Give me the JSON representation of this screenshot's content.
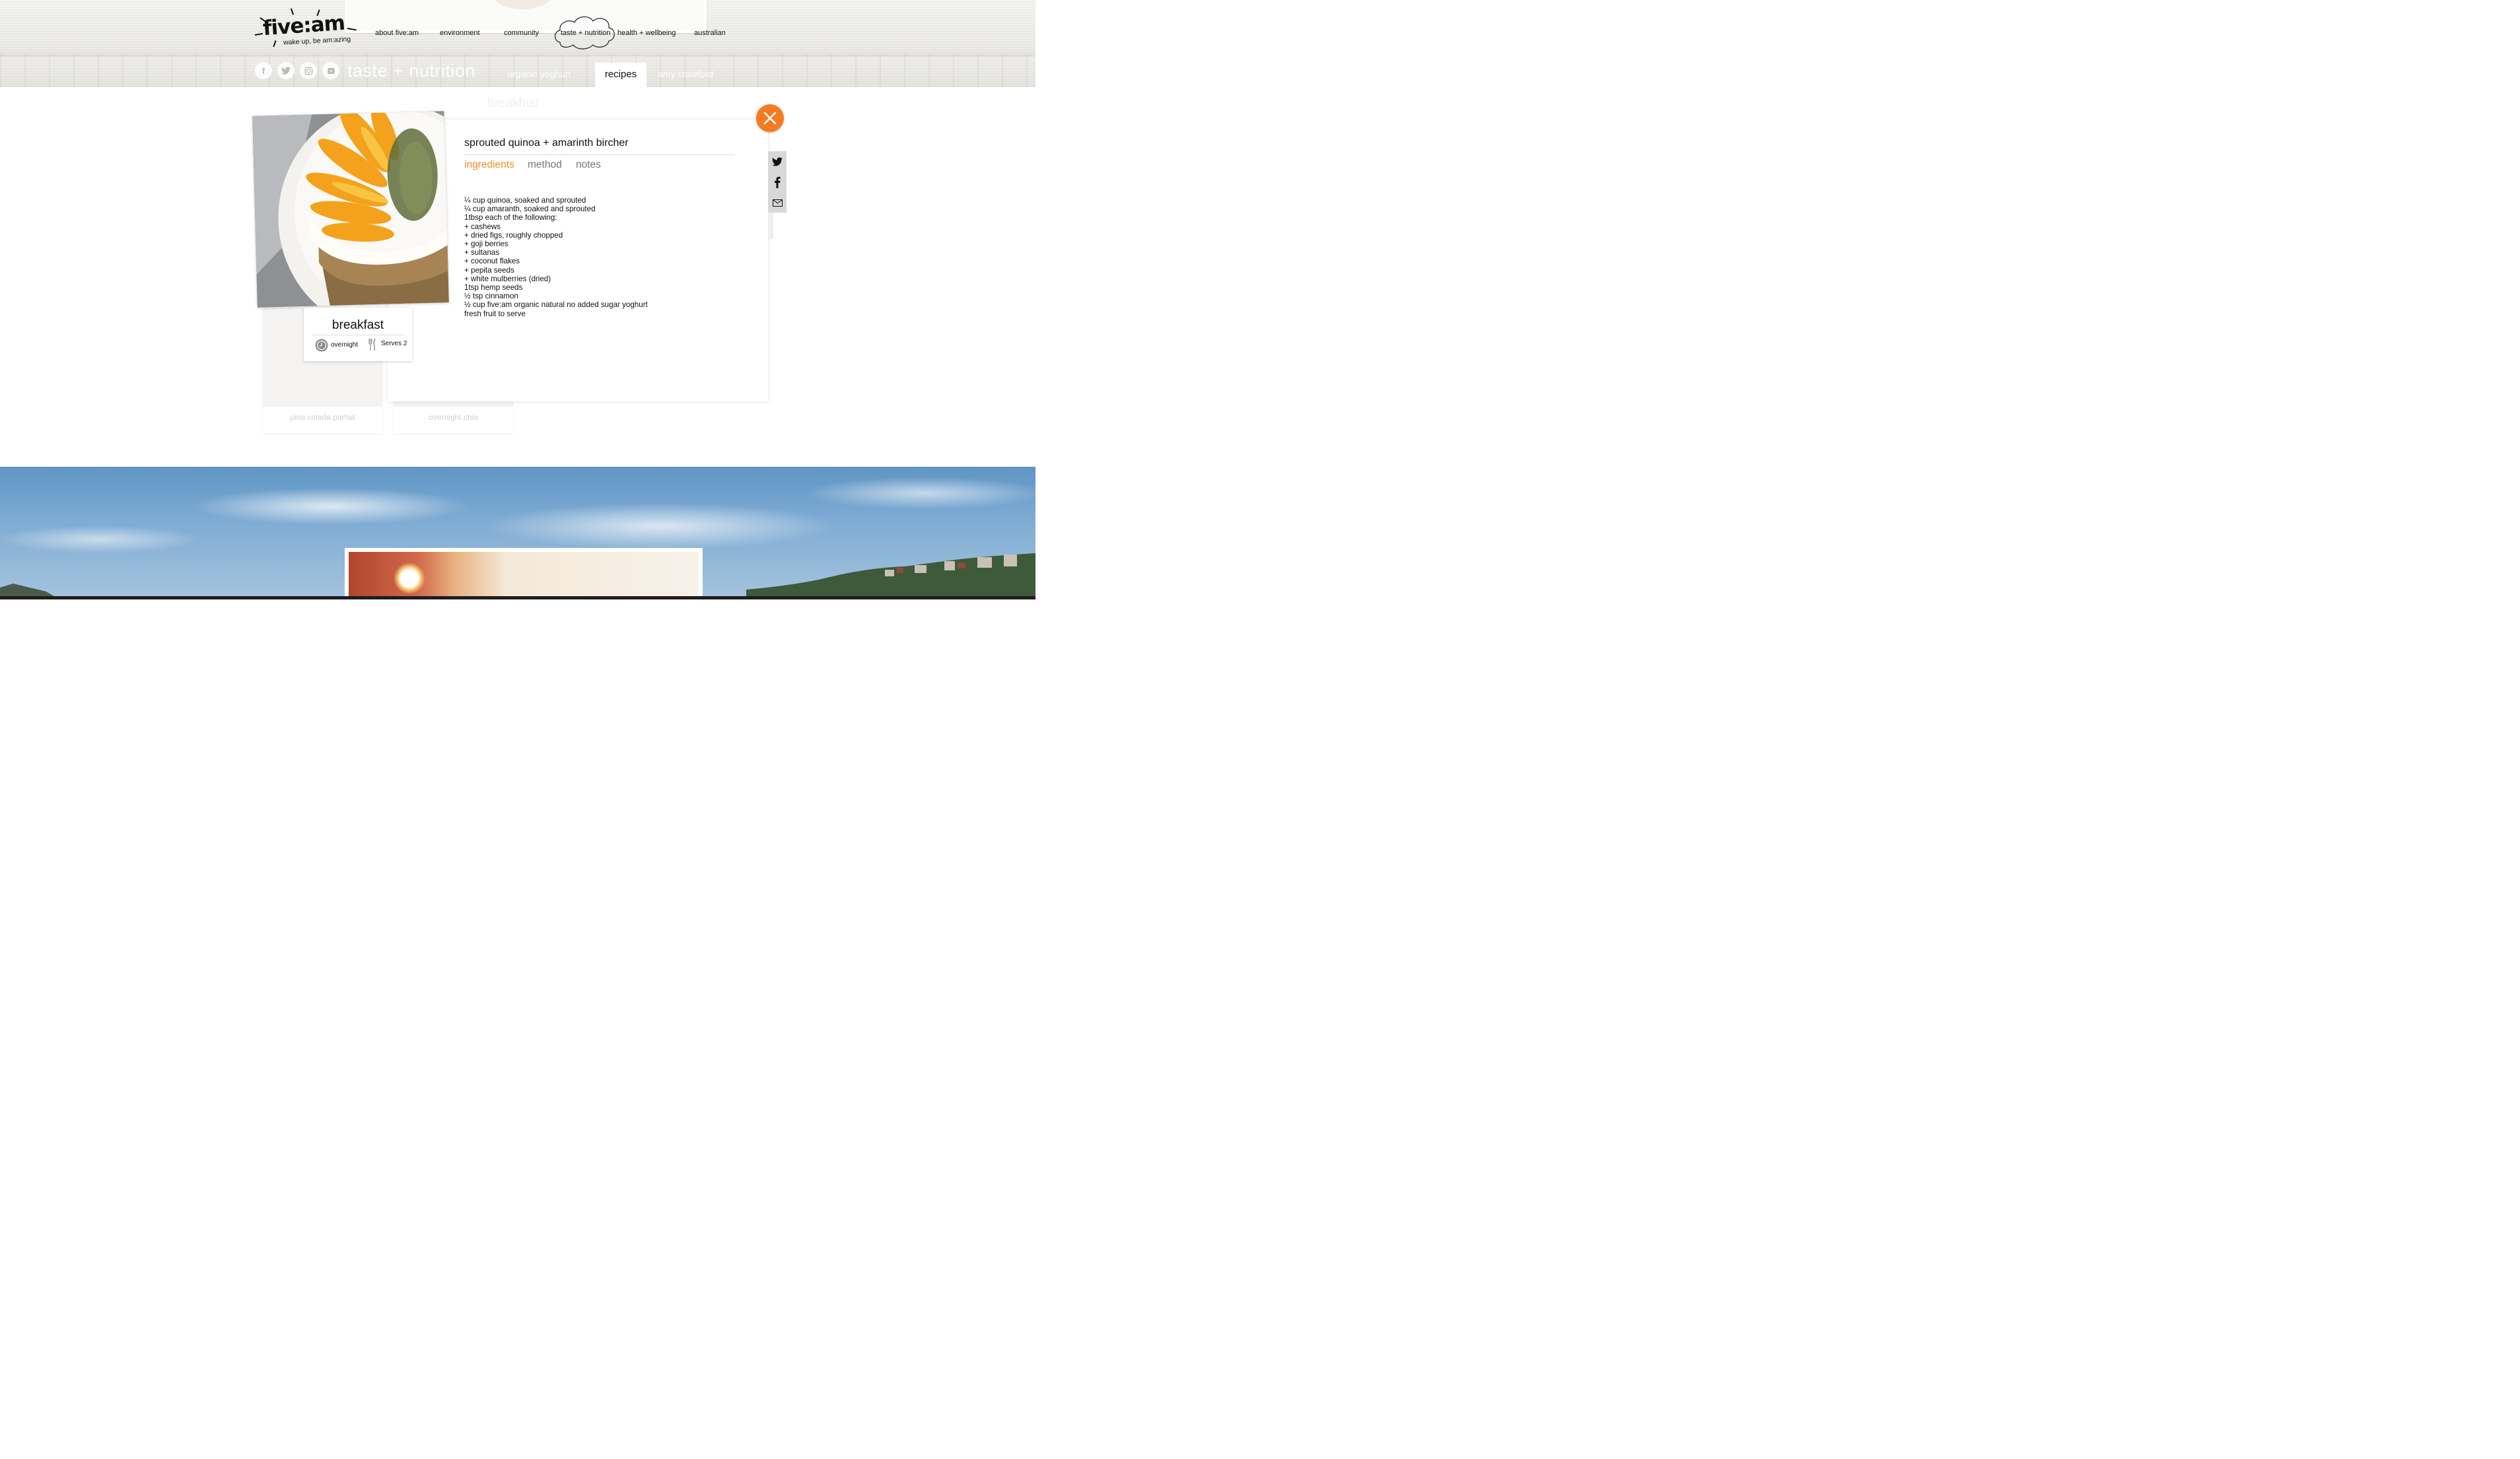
{
  "brand": {
    "name": "five:am",
    "tagline": "wake up, be am:azing"
  },
  "nav": {
    "items": [
      {
        "label": "about five:am"
      },
      {
        "label": "environment"
      },
      {
        "label": "community"
      },
      {
        "label": "taste + nutrition",
        "active": true
      },
      {
        "label": "health + wellbeing"
      },
      {
        "label": "australian"
      }
    ]
  },
  "social_icons": [
    "facebook-icon",
    "twitter-icon",
    "instagram-icon",
    "youtube-icon"
  ],
  "section": {
    "title": "taste + nutrition",
    "tabs": [
      {
        "label": "organic yoghurt"
      },
      {
        "label": "recipes",
        "active": true
      },
      {
        "label": "amy crawford"
      }
    ]
  },
  "background_grid": {
    "heading": "breakfast",
    "cards": [
      {
        "caption": "pina colada parfait"
      },
      {
        "caption": "overnight chia"
      }
    ]
  },
  "recipe": {
    "title": "sprouted quinoa + amarinth bircher",
    "tabs": [
      {
        "label": "ingredients",
        "active": true
      },
      {
        "label": "method"
      },
      {
        "label": "notes"
      }
    ],
    "ingredients": [
      "¼ cup quinoa, soaked and sprouted",
      "¼ cup amaranth, soaked and sprouted",
      "1tbsp each of the following:",
      "+ cashews",
      "+ dried figs, roughly chopped",
      "+ goji berries",
      "+ sultanas",
      "+ coconut flakes",
      "+ pepita seeds",
      "+ white mulberries (dried)",
      "1tsp hemp seeds",
      "½ tsp cinnamon",
      "½ cup five:am organic natural no added sugar yoghurt",
      "fresh fruit to serve"
    ],
    "category": "breakfast",
    "time": "overnight",
    "serves": "Serves 2"
  },
  "share": [
    "twitter-icon",
    "facebook-icon",
    "email-icon"
  ],
  "colors": {
    "accent": "#f47b20",
    "tab_active": "#f08a24",
    "tab_inactive": "#777777"
  }
}
